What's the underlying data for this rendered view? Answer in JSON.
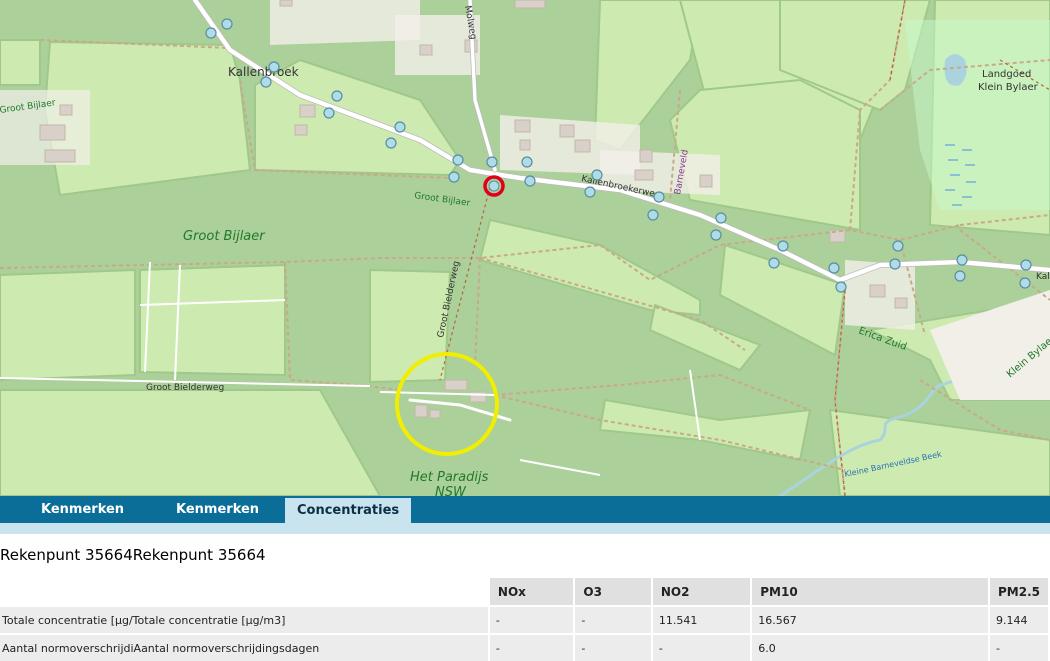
{
  "map": {
    "labels": {
      "kallenbroek": "Kallenbroek",
      "groot_bijlaer_big": "Groot Bijlaer",
      "groot_bijlaer_small": "Groot Bijlaer",
      "groot_bijlaer_left": "Groot Bijlaer",
      "kallenbroekerweg": "Kallenbroekerweg",
      "molweg": "Molweg",
      "barneveld": "Barneveld",
      "landgoed_line1": "Landgoed",
      "landgoed_line2": "Klein Bylaer",
      "groot_bielderweg_vertical": "Groot Bielderweg",
      "groot_bielderweg_horizontal": "Groot Bielderweg",
      "erica_zuid": "Erica Zuid",
      "klein_bylaer": "Klein Bylaer",
      "het_paradijs_line1": "Het Paradijs",
      "het_paradijs_line2": "NSW",
      "klein_barneveldse_beek": "Kleine Barneveldse Beek",
      "kal_cut": "Kal"
    },
    "colors": {
      "forest": "#acd09a",
      "meadow": "#cdebb0",
      "road": "#ffffff",
      "path": "#b5663b",
      "water": "#aad3df",
      "marker_fill": "#aedce8",
      "selected_ring": "#e0001a",
      "highlight_circle": "#f2ee00"
    }
  },
  "tabs": [
    {
      "label": "Kenmerken",
      "active": false
    },
    {
      "label": "Kenmerken",
      "active": false
    },
    {
      "label": "Concentraties",
      "active": true
    }
  ],
  "panel": {
    "title": "Rekenpunt 35664Rekenpunt 35664",
    "table": {
      "headers": [
        "",
        "NOx",
        "O3",
        "NO2",
        "PM10",
        "PM2.5"
      ],
      "rows": [
        [
          "Totale concentratie [µg/Totale concentratie [µg/m3]",
          "-",
          "-",
          "11.541",
          "16.567",
          "9.144"
        ],
        [
          "Aantal normoverschrijdiAantal normoverschrijdingsdagen",
          "-",
          "-",
          "-",
          "6.0",
          "-"
        ]
      ]
    }
  }
}
